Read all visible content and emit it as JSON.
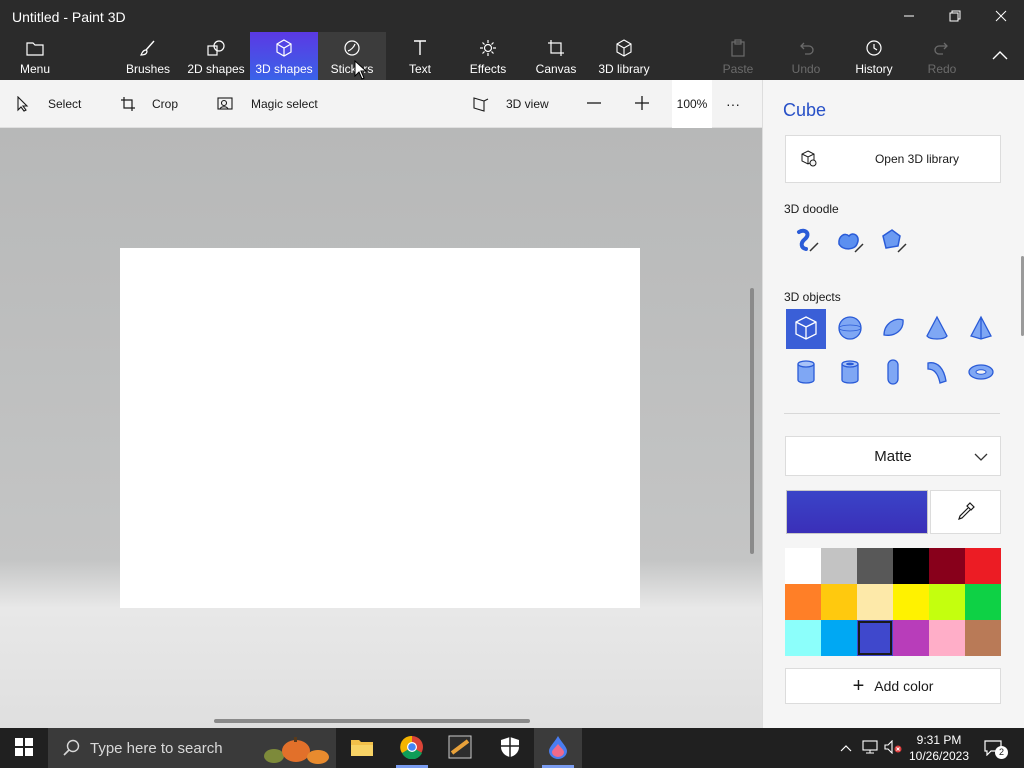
{
  "window": {
    "title": "Untitled - Paint 3D"
  },
  "ribbon": {
    "menu": "Menu",
    "tabs": [
      {
        "label": "Brushes",
        "icon": "brush-icon"
      },
      {
        "label": "2D shapes",
        "icon": "2d-shapes-icon"
      },
      {
        "label": "3D shapes",
        "icon": "3d-shapes-icon",
        "active": true
      },
      {
        "label": "Stickers",
        "icon": "stickers-icon"
      },
      {
        "label": "Text",
        "icon": "text-icon"
      },
      {
        "label": "Effects",
        "icon": "effects-icon"
      },
      {
        "label": "Canvas",
        "icon": "canvas-icon"
      },
      {
        "label": "3D library",
        "icon": "3d-library-icon"
      }
    ],
    "actions": [
      {
        "label": "Paste",
        "disabled": true
      },
      {
        "label": "Undo",
        "disabled": true
      },
      {
        "label": "History",
        "disabled": false
      },
      {
        "label": "Redo",
        "disabled": true
      }
    ]
  },
  "toolbar": {
    "select": "Select",
    "crop": "Crop",
    "magic_select": "Magic select",
    "view_3d": "3D view",
    "zoom": "100%",
    "more": "···"
  },
  "panel": {
    "title": "Cube",
    "open_library": "Open 3D library",
    "doodle_heading": "3D doodle",
    "objects_heading": "3D objects",
    "material": "Matte",
    "current_color": "#3a44c8",
    "add_color": "Add color",
    "palette": [
      "#ffffff",
      "#c3c3c3",
      "#585858",
      "#000000",
      "#88001b",
      "#ec1c24",
      "#ff7f27",
      "#ffc90e",
      "#fde9a9",
      "#fff200",
      "#c4ff0e",
      "#0ed145",
      "#8cfffb",
      "#00a8f3",
      "#3f48cc",
      "#b83dba",
      "#ffaec8",
      "#b97a57"
    ],
    "selected_swatch": 14
  },
  "taskbar": {
    "search_placeholder": "Type here to search",
    "time": "9:31 PM",
    "date": "10/26/2023",
    "notifications": "2"
  }
}
